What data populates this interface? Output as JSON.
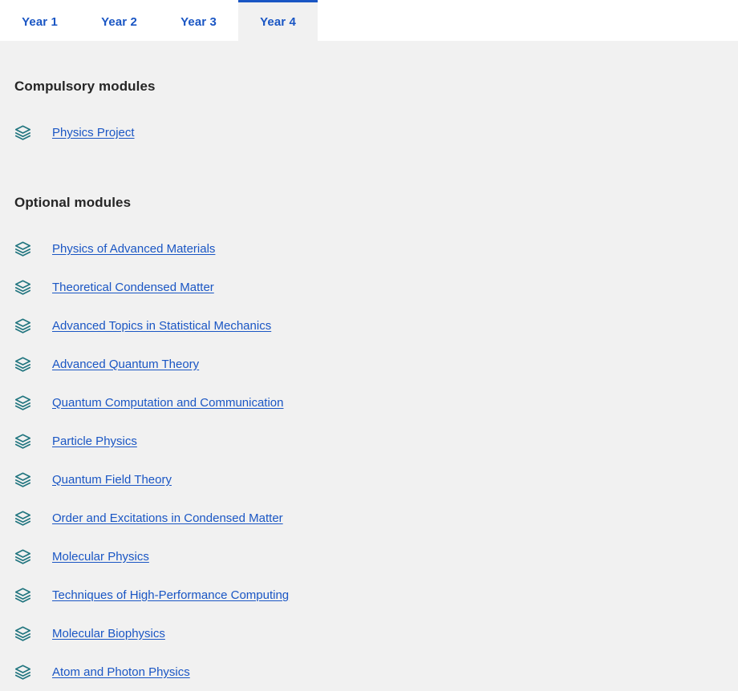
{
  "colors": {
    "accent_blue": "#1a56c4",
    "icon_teal": "#21757f",
    "content_bg": "#f1f1f1",
    "tabbar_bg": "#ffffff",
    "heading_text": "#262626"
  },
  "tabs": [
    {
      "label": "Year 1",
      "active": false
    },
    {
      "label": "Year 2",
      "active": false
    },
    {
      "label": "Year 3",
      "active": false
    },
    {
      "label": "Year 4",
      "active": true
    }
  ],
  "sections": [
    {
      "heading": "Compulsory modules",
      "icon": "layers-icon",
      "modules": [
        {
          "label": "Physics Project"
        }
      ]
    },
    {
      "heading": "Optional modules",
      "icon": "layers-icon",
      "modules": [
        {
          "label": "Physics of Advanced Materials"
        },
        {
          "label": "Theoretical Condensed Matter"
        },
        {
          "label": "Advanced Topics in Statistical Mechanics"
        },
        {
          "label": "Advanced Quantum Theory"
        },
        {
          "label": "Quantum Computation and Communication"
        },
        {
          "label": "Particle Physics"
        },
        {
          "label": "Quantum Field Theory"
        },
        {
          "label": "Order and Excitations in Condensed Matter"
        },
        {
          "label": "Molecular Physics"
        },
        {
          "label": "Techniques of High-Performance Computing"
        },
        {
          "label": "Molecular Biophysics"
        },
        {
          "label": "Atom and Photon Physics"
        }
      ]
    }
  ]
}
